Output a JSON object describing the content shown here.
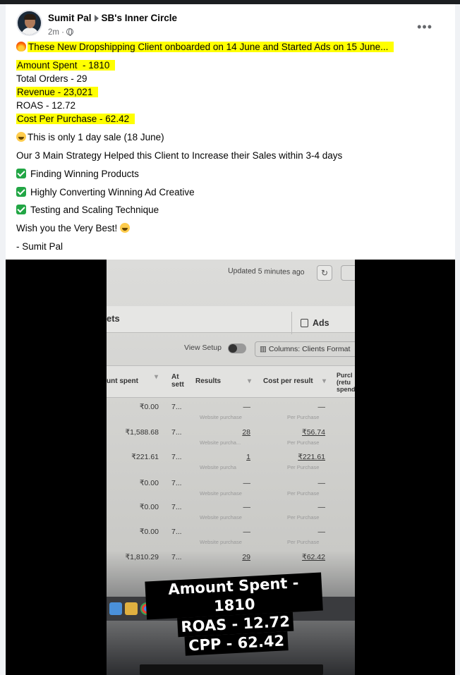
{
  "post": {
    "author": "Sumit Pal",
    "group": "SB's Inner Circle",
    "time": "2m ·",
    "headline": "These New Dropshipping Client onboarded on 14 June and Started Ads on 15 June...",
    "lines": {
      "amount_spent": "Amount Spent  - 1810",
      "total_orders": "Total Orders - 29",
      "revenue": "Revenue - 23,021",
      "roas": "ROAS - 12.72",
      "cpp": "Cost Per Purchase - 62.42",
      "one_day": "This is only 1 day sale (18 June)",
      "strategy": "Our 3 Main Strategy Helped this Client to Increase their Sales within 3-4 days",
      "s1": "Finding Winning Products",
      "s2": "Highly Converting Winning Ad Creative",
      "s3": "Testing and Scaling Technique",
      "wish": "Wish you the Very Best!",
      "sign": "- Sumit Pal"
    },
    "menu_icon": "more-horizontal-icon",
    "highlight_color": "#ffff00"
  },
  "video": {
    "screen": {
      "updated": "Updated 5 minutes ago",
      "refresh_icon": "↻",
      "tab_partial": "ets",
      "ads_tab": "Ads",
      "view_setup": "View Setup",
      "columns": "Columns: Clients Format",
      "headers": {
        "amount": "unt spent",
        "attr": "At sett",
        "results": "Results",
        "cost": "Cost per result",
        "purch": "Purcl (retu spend"
      },
      "rows": [
        {
          "amount": "₹0.00",
          "attr": "7...",
          "results": "—",
          "cost": "—",
          "sub_r": "Website purchase",
          "sub_c": "Per Purchase"
        },
        {
          "amount": "₹1,588.68",
          "attr": "7...",
          "results": "28",
          "cost": "₹56.74",
          "sub_r": "Website purcha...",
          "sub_c": "Per Purchase"
        },
        {
          "amount": "₹221.61",
          "attr": "7...",
          "results": "1",
          "cost": "₹221.61",
          "sub_r": "Website purcha",
          "sub_c": "Per Purchase"
        },
        {
          "amount": "₹0.00",
          "attr": "7...",
          "results": "—",
          "cost": "—",
          "sub_r": "Website purchase",
          "sub_c": "Per Purchase"
        },
        {
          "amount": "₹0.00",
          "attr": "7...",
          "results": "—",
          "cost": "—",
          "sub_r": "Website purchase",
          "sub_c": "Per Purchase"
        },
        {
          "amount": "₹0.00",
          "attr": "7...",
          "results": "—",
          "cost": "—",
          "sub_r": "Website purchase",
          "sub_c": "Per Purchase"
        },
        {
          "amount": "₹1,810.29",
          "attr": "7...",
          "results": "29",
          "cost": "₹62.42",
          "sub_r": "",
          "sub_c": ""
        }
      ]
    },
    "caption": {
      "l1": "Amount Spent - 1810",
      "l2": "ROAS - 12.72",
      "l3": "CPP - 62.42"
    }
  }
}
